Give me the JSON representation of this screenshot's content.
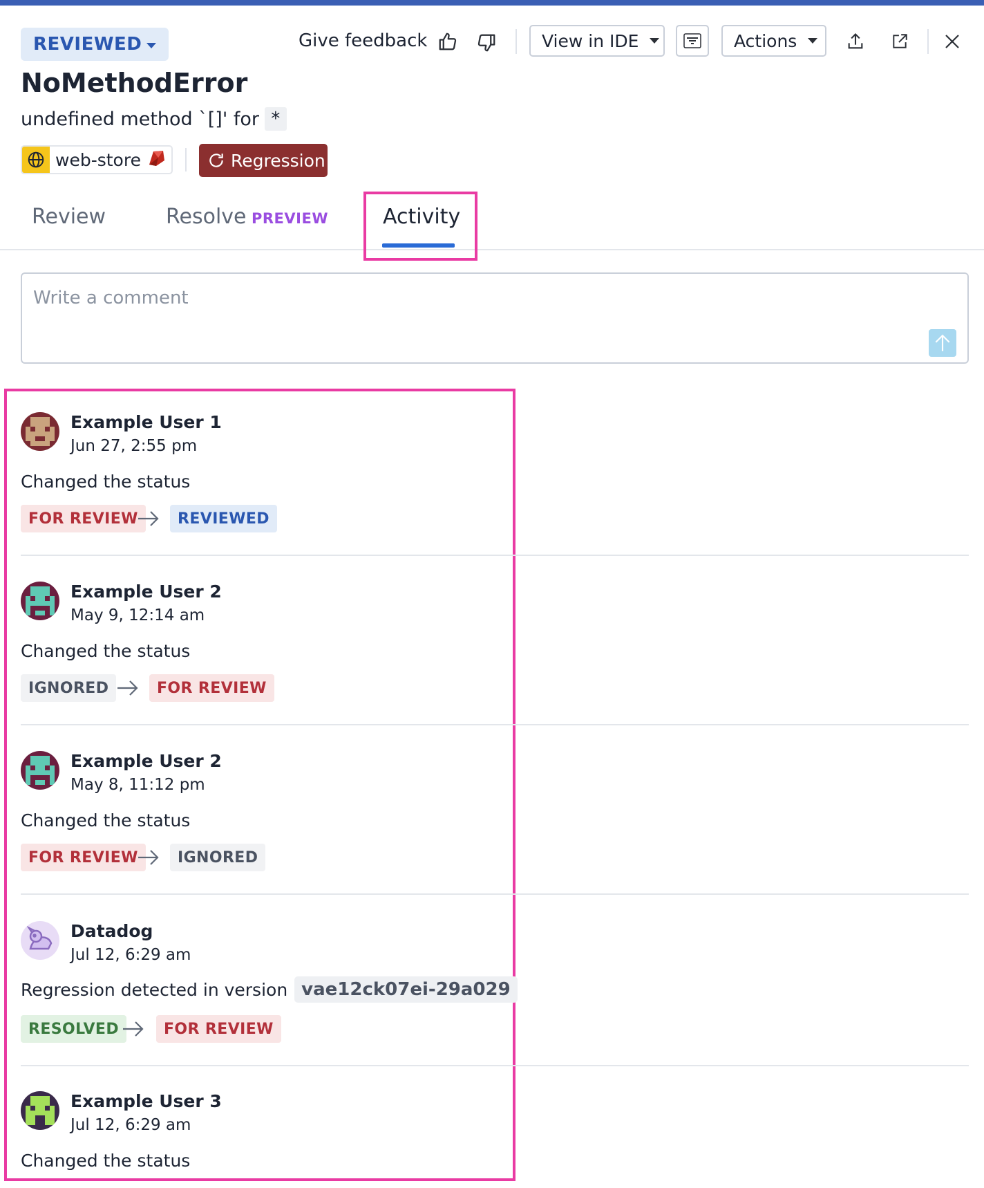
{
  "header": {
    "status_label": "REVIEWED",
    "give_feedback": "Give feedback",
    "view_in_ide": "View in IDE",
    "actions": "Actions"
  },
  "issue": {
    "title": "NoMethodError",
    "subtitle": "undefined method `[]' for",
    "subtitle_code": "*",
    "service": "web-store",
    "regression_label": "Regression"
  },
  "tabs": {
    "review": "Review",
    "resolve": "Resolve",
    "resolve_badge": "PREVIEW",
    "activity": "Activity"
  },
  "comment": {
    "placeholder": "Write a comment"
  },
  "activity": [
    {
      "user": "Example User 1",
      "time": "Jun 27, 2:55 pm",
      "message": "Changed the status",
      "from": "FOR REVIEW",
      "to": "REVIEWED"
    },
    {
      "user": "Example User 2",
      "time": "May 9, 12:14 am",
      "message": "Changed the status",
      "from": "IGNORED",
      "to": "FOR REVIEW"
    },
    {
      "user": "Example User 2",
      "time": "May 8, 11:12 pm",
      "message": "Changed the status",
      "from": "FOR REVIEW",
      "to": "IGNORED"
    },
    {
      "user": "Datadog",
      "time": "Jul 12, 6:29 am",
      "message": "Regression detected in version",
      "version": "vae12ck07ei-29a029",
      "from": "RESOLVED",
      "to": "FOR REVIEW"
    },
    {
      "user": "Example User 3",
      "time": "Jul 12, 6:29 am",
      "message": "Changed the status"
    }
  ],
  "colors": {
    "accent": "#2a6bd6",
    "highlight": "#e93ba3",
    "regression": "#8b2f2f"
  }
}
